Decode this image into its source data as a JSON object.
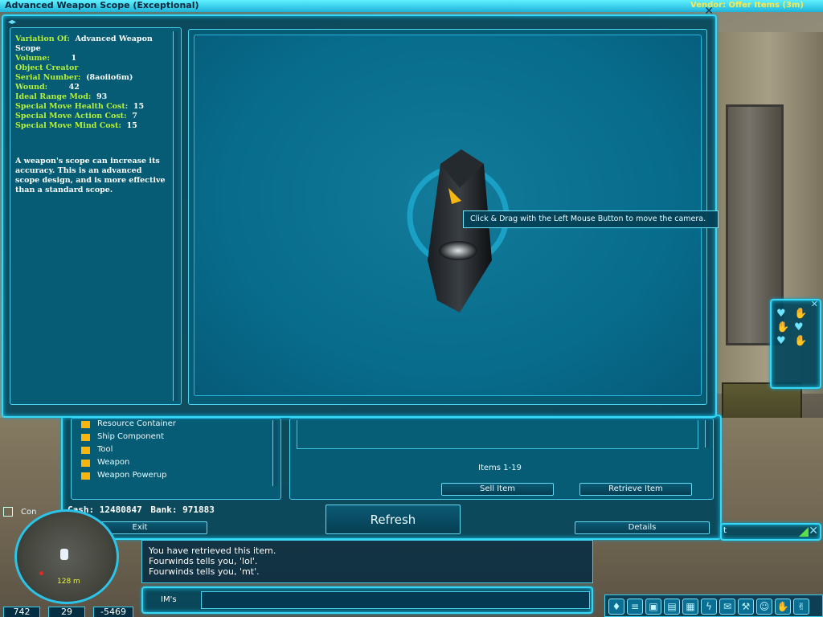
{
  "window": {
    "title": "Advanced Weapon Scope (Exceptional)",
    "vendor_tab": "Vendor: Offer Items (3m)"
  },
  "item": {
    "attributes": [
      {
        "key": "Variation Of:",
        "value": "Advanced Weapon Scope"
      },
      {
        "key": "Volume:",
        "value": "1"
      },
      {
        "key": "Object Creator",
        "value": ""
      },
      {
        "key": "Serial Number:",
        "value": "(8aoiio6m)"
      },
      {
        "key": "Wound:",
        "value": "42"
      },
      {
        "key": "Ideal Range Mod:",
        "value": "93"
      },
      {
        "key": "Special Move Health Cost:",
        "value": "15"
      },
      {
        "key": "Special Move Action Cost:",
        "value": "7"
      },
      {
        "key": "Special Move Mind Cost:",
        "value": "15"
      }
    ],
    "description": "A weapon's scope can increase its accuracy.  This is an advanced scope design, and is more effective than a standard scope."
  },
  "viewer": {
    "tooltip": "Click & Drag with the Left Mouse Button to move the camera."
  },
  "vendor": {
    "categories": [
      "Resource Container",
      "Ship Component",
      "Tool",
      "Weapon",
      "Weapon Powerup"
    ],
    "items_count": "Items 1-19",
    "sell_label": "Sell Item",
    "retrieve_label": "Retrieve Item",
    "cash_label": "Cash:",
    "cash_value": "12480847",
    "bank_label": "Bank:",
    "bank_value": "971883",
    "refresh_label": "Refresh",
    "exit_label": "Exit",
    "details_label": "Details"
  },
  "chat": {
    "lines": [
      "You have retrieved this item.",
      "Fourwinds tells you, 'lol'.",
      "Fourwinds tells you, 'mt'."
    ],
    "ims_label": "IM's"
  },
  "hud": {
    "con_label": "Con",
    "map_distance": "128 m",
    "coords": [
      "742",
      "29",
      "-5469"
    ],
    "right_input_value": "t"
  },
  "colors": {
    "panel_border": "#35d8f5",
    "attr_key": "#b7f23a",
    "category_bullet": "#f6b510",
    "vendor_tab_text": "#ffe84a"
  }
}
